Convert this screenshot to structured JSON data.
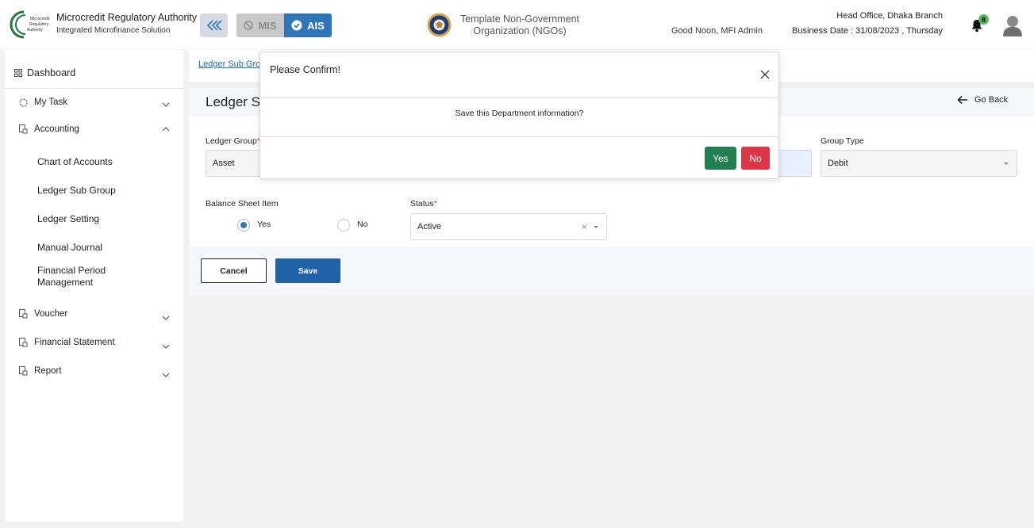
{
  "header": {
    "logo_text": [
      "Microcredit",
      "Regulatory",
      "Authority"
    ],
    "org_name": "Microcredit Regulatory Authority",
    "org_sub": "Integrated Microfinance Solution",
    "mis_label": "MIS",
    "ais_label": "AIS",
    "ngo_line1": "Template Non-Government",
    "ngo_line2": "Organization (NGOs)",
    "greeting": "Good Noon, MFI Admin",
    "branch": "Head Office, Dhaka Branch",
    "business_date": "Business Date : 31/08/2023 , Thursday",
    "notification_count": "8"
  },
  "sidebar": {
    "dashboard": "Dashboard",
    "my_task": "My Task",
    "accounting": "Accounting",
    "accounting_items": [
      "Chart of Accounts",
      "Ledger Sub Group",
      "Ledger Setting",
      "Manual Journal",
      "Financial Period",
      "Management"
    ],
    "voucher": "Voucher",
    "financial_statement": "Financial Statement",
    "report": "Report"
  },
  "main": {
    "breadcrumb": "Ledger Sub Gro",
    "page_title": "Ledger S",
    "go_back": "Go Back",
    "ledger_group_label": "Ledger Group",
    "ledger_group_value": "Asset",
    "group_type_label": "Group Type",
    "group_type_value": "Debit",
    "balance_sheet_label": "Balance Sheet Item",
    "radio_yes": "Yes",
    "radio_no": "No",
    "status_label": "Status",
    "status_value": "Active",
    "cancel": "Cancel",
    "save": "Save"
  },
  "modal": {
    "title": "Please Confirm!",
    "message": "Save this Department information?",
    "yes": "Yes",
    "no": "No"
  },
  "colors": {
    "primary": "#1f62a8",
    "ais_active": "#2f76b8",
    "confirm_yes": "#218050",
    "confirm_no": "#dc3545",
    "badge": "#5cb85c"
  }
}
